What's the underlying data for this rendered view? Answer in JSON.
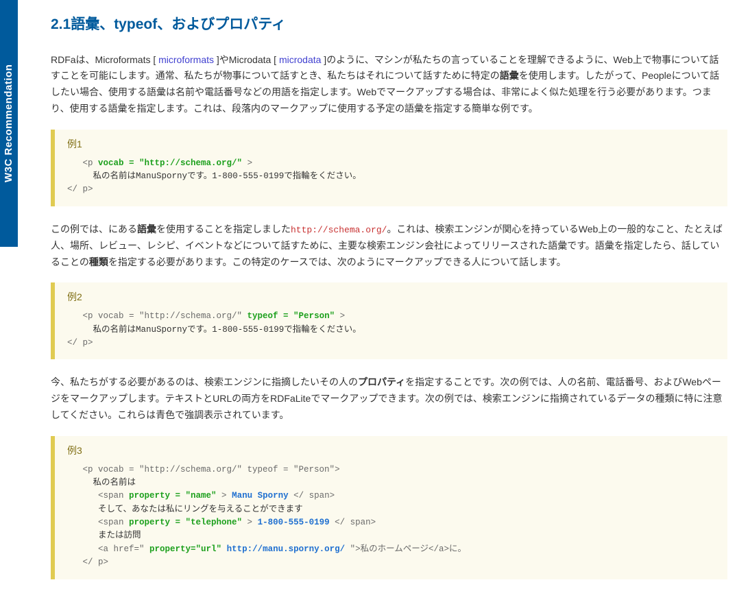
{
  "sideTab": "W3C Recommendation",
  "heading": "2.1語彙、typeof、およびプロパティ",
  "p1": {
    "a": "RDFaは、Microformats [ ",
    "link1": "microformats",
    "b": " ]やMicrodata [ ",
    "link2": "microdata",
    "c": " ]のように、マシンが私たちの言っていることを理解できるように、Web上で物事について話すことを可能にします。通常、私たちが物事について話すとき、私たちはそれについて話すために特定の",
    "strong1": "語彙",
    "d": "を使用します。したがって、Peopleについて話したい場合、使用する語彙は名前や電話番号などの用語を指定します。Webでマークアップする場合は、非常によく似た処理を行う必要があります。つまり、使用する語彙を指定します。これは、段落内のマークアップに使用する予定の語彙を指定する簡単な例です。"
  },
  "ex1": {
    "title": "例1",
    "l1a": "   <p ",
    "l1b": "vocab = \"http://schema.org/\"",
    "l1c": " >",
    "l2": "     私の名前はManuSpornyです。1-800-555-0199で指輪をください。",
    "l3": "</ p>"
  },
  "p2": {
    "a": "この例では、にある",
    "strong1": "語彙",
    "b": "を使用することを指定しました",
    "url": "http://schema.org/",
    "c": "。これは、検索エンジンが関心を持っているWeb上の一般的なこと、たとえば人、場所、レビュー、レシピ、イベントなどについて話すために、主要な検索エンジン会社によってリリースされた語彙です。語彙を指定したら、話していることの",
    "strong2": "種類",
    "d": "を指定する必要があります。この特定のケースでは、次のようにマークアップできる人について話します。"
  },
  "ex2": {
    "title": "例2",
    "l1a": "   <p vocab = \"http://schema.org/\" ",
    "l1b": "typeof = \"Person\"",
    "l1c": " >",
    "l2": "     私の名前はManuSpornyです。1-800-555-0199で指輪をください。",
    "l3": "</ p>"
  },
  "p3": {
    "a": "今、私たちがする必要があるのは、検索エンジンに指摘したいその人の",
    "strong1": "プロパティ",
    "b": "を指定することです。次の例では、人の名前、電話番号、およびWebページをマークアップします。テキストとURLの両方をRDFaLiteでマークアップできます。次の例では、検索エンジンに指摘されているデータの種類に特に注意してください。これらは青色で強調表示されています。"
  },
  "ex3": {
    "title": "例3",
    "l1": "   <p vocab = \"http://schema.org/\" typeof = \"Person\">",
    "l2": "     私の名前は",
    "l3a": "      <span ",
    "l3b": "property = \"name\"",
    "l3c": " > ",
    "l3d": "Manu Sporny",
    "l3e": " </ span>",
    "l4": "      そして、あなたは私にリングを与えることができます",
    "l5a": "      <span ",
    "l5b": "property = \"telephone\"",
    "l5c": " > ",
    "l5d": "1-800-555-0199",
    "l5e": " </ span>",
    "l6": "      または訪問",
    "l7a": "      <a href=\" ",
    "l7b": "property=\"url\"",
    "l7c": " ",
    "l7d": "http://manu.sporny.org/",
    "l7e": " \">私のホームページ</a>に。",
    "l8": "   </ p>"
  }
}
